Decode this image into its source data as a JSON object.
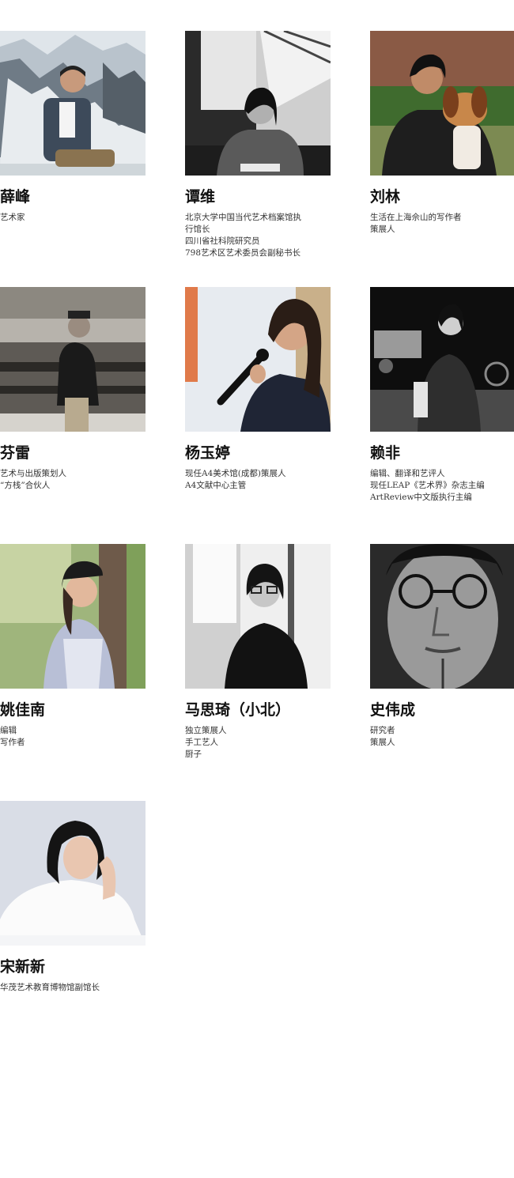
{
  "people": [
    {
      "name": "薛峰",
      "roles": [
        "艺术家"
      ]
    },
    {
      "name": "谭维",
      "roles": [
        "北京大学中国当代艺术档案馆执",
        "行馆长",
        "四川省社科院研究员",
        "798艺术区艺术委员会副秘书长"
      ]
    },
    {
      "name": "刘林",
      "roles": [
        "生活在上海佘山的写作者",
        "策展人"
      ]
    },
    {
      "name": "芬雷",
      "roles": [
        "艺术与出版策划人",
        "“方栈”合伙人"
      ]
    },
    {
      "name": "杨玉婷",
      "roles": [
        "现任A4美术馆(成都)策展人",
        "A4文献中心主管"
      ]
    },
    {
      "name": "赖非",
      "roles": [
        "编辑、翻译和艺评人",
        "现任LEAP《艺术界》杂志主编",
        "ArtReview中文版执行主编"
      ]
    },
    {
      "name": "姚佳南",
      "roles": [
        "编辑",
        "写作者"
      ]
    },
    {
      "name": "马思琦（小北）",
      "roles": [
        "独立策展人",
        "手工艺人",
        "厨子"
      ]
    },
    {
      "name": "史伟成",
      "roles": [
        "研究者",
        "策展人"
      ]
    },
    {
      "name": "宋新新",
      "roles": [
        "华茂艺术教育博物馆副馆长"
      ]
    }
  ]
}
